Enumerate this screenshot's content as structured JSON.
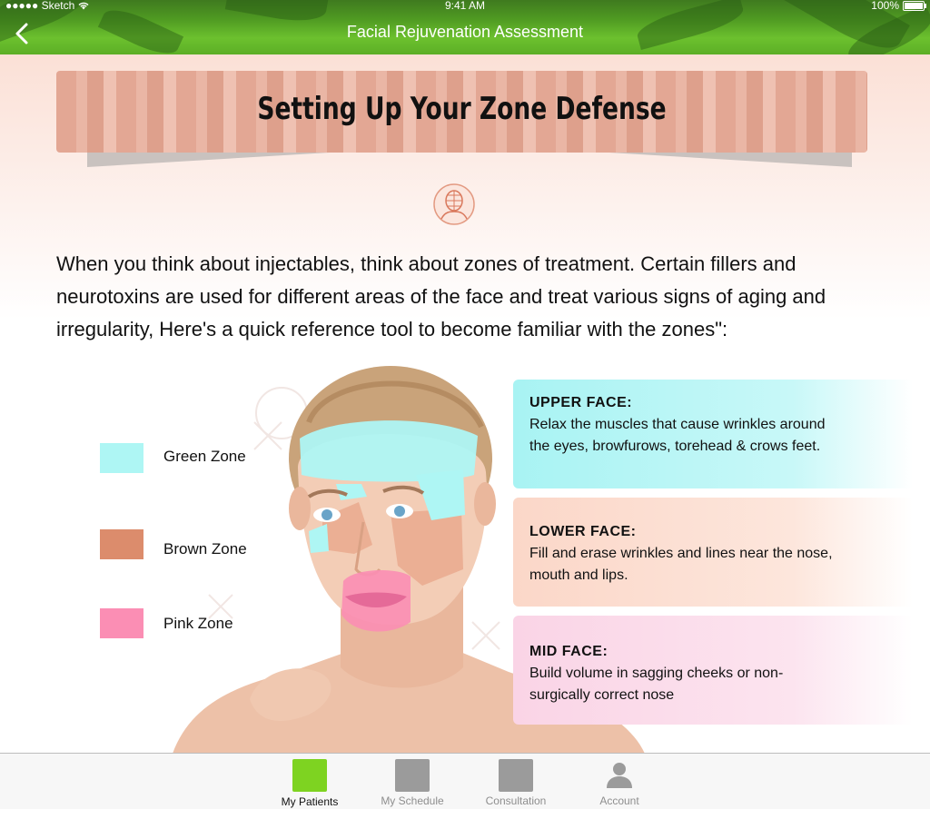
{
  "status": {
    "carrier": "●●●●● Sketch",
    "time": "9:41 AM",
    "battery": "100%"
  },
  "nav": {
    "title": "Facial Rejuvenation Assessment",
    "back_icon": "chevron-left-icon"
  },
  "banner": {
    "title": "Setting Up Your Zone Defense"
  },
  "intro": "When you think about injectables, think about zones of treatment. Certain fillers and neurotoxins are used for different areas of the face and treat various signs of aging and irregularity, Here's a quick reference tool to become familiar with the zones\":",
  "legend": [
    {
      "label": "Green Zone",
      "color": "#aef6f4"
    },
    {
      "label": "Brown Zone",
      "color": "#dc8c6c"
    },
    {
      "label": "Pink Zone",
      "color": "#fb8eb4"
    }
  ],
  "cards": [
    {
      "title": "UPPER FACE:",
      "body": "Relax the muscles that cause wrinkles around the eyes, browfurows, torehead & crows feet.",
      "color": "#a8f3f3"
    },
    {
      "title": "LOWER FACE:",
      "body": "Fill and erase wrinkles and lines near the nose, mouth and lips.",
      "color": "#fbd7c8"
    },
    {
      "title": "MID FACE:",
      "body": "Build volume in sagging cheeks or non-surgically correct nose",
      "color": "#fad4e6"
    }
  ],
  "tabs": [
    {
      "label": "My Patients",
      "icon": "patients-icon",
      "active": true
    },
    {
      "label": "My Schedule",
      "icon": "schedule-icon",
      "active": false
    },
    {
      "label": "Consultation",
      "icon": "consultation-icon",
      "active": false
    },
    {
      "label": "Account",
      "icon": "account-icon",
      "active": false
    }
  ],
  "colors": {
    "nav_green": "#5cae26",
    "tab_active": "#7ed321",
    "tab_inactive": "#9b9b9b",
    "banner": "#e3a794"
  }
}
